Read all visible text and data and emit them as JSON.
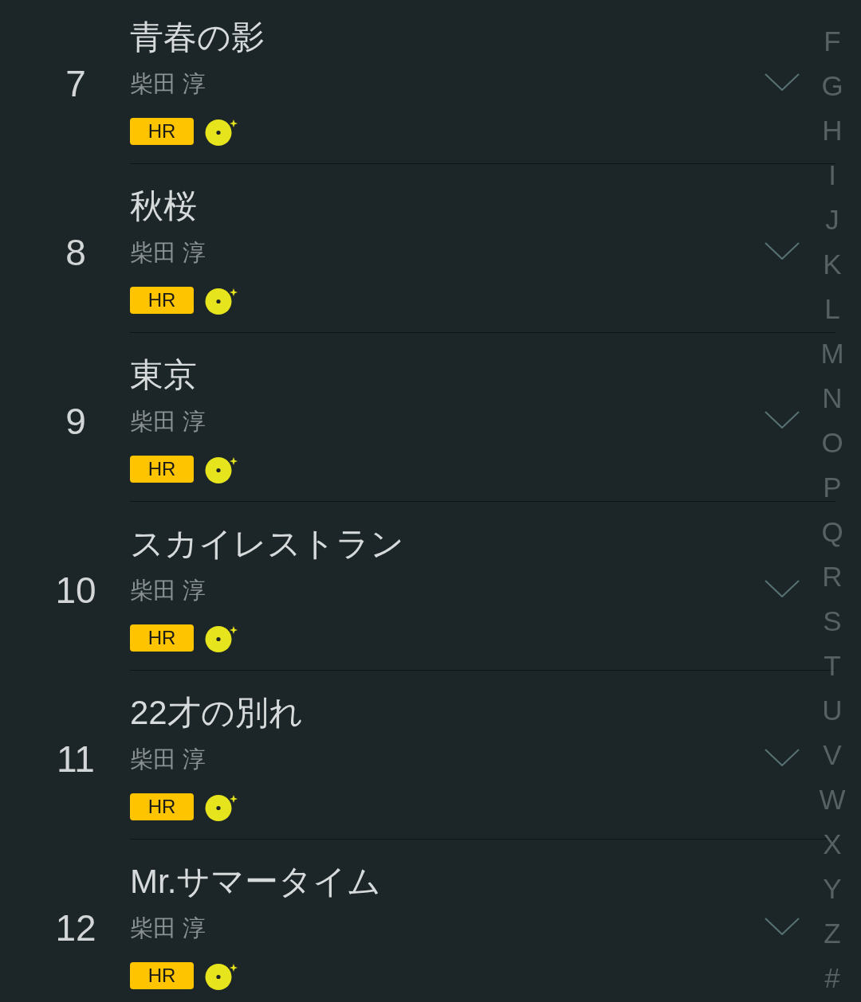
{
  "tracks": [
    {
      "number": "7",
      "title": "青春の影",
      "artist": "柴田 淳",
      "badge": "HR"
    },
    {
      "number": "8",
      "title": "秋桜",
      "artist": "柴田 淳",
      "badge": "HR"
    },
    {
      "number": "9",
      "title": "東京",
      "artist": "柴田 淳",
      "badge": "HR"
    },
    {
      "number": "10",
      "title": "スカイレストラン",
      "artist": "柴田 淳",
      "badge": "HR"
    },
    {
      "number": "11",
      "title": "22才の別れ",
      "artist": "柴田 淳",
      "badge": "HR"
    },
    {
      "number": "12",
      "title": "Mr.サマータイム",
      "artist": "柴田 淳",
      "badge": "HR"
    }
  ],
  "index": {
    "letters": [
      "F",
      "G",
      "H",
      "I",
      "J",
      "K",
      "L",
      "M",
      "N",
      "O",
      "P",
      "Q",
      "R",
      "S",
      "T",
      "U",
      "V",
      "W",
      "X",
      "Y",
      "Z",
      "#"
    ]
  }
}
